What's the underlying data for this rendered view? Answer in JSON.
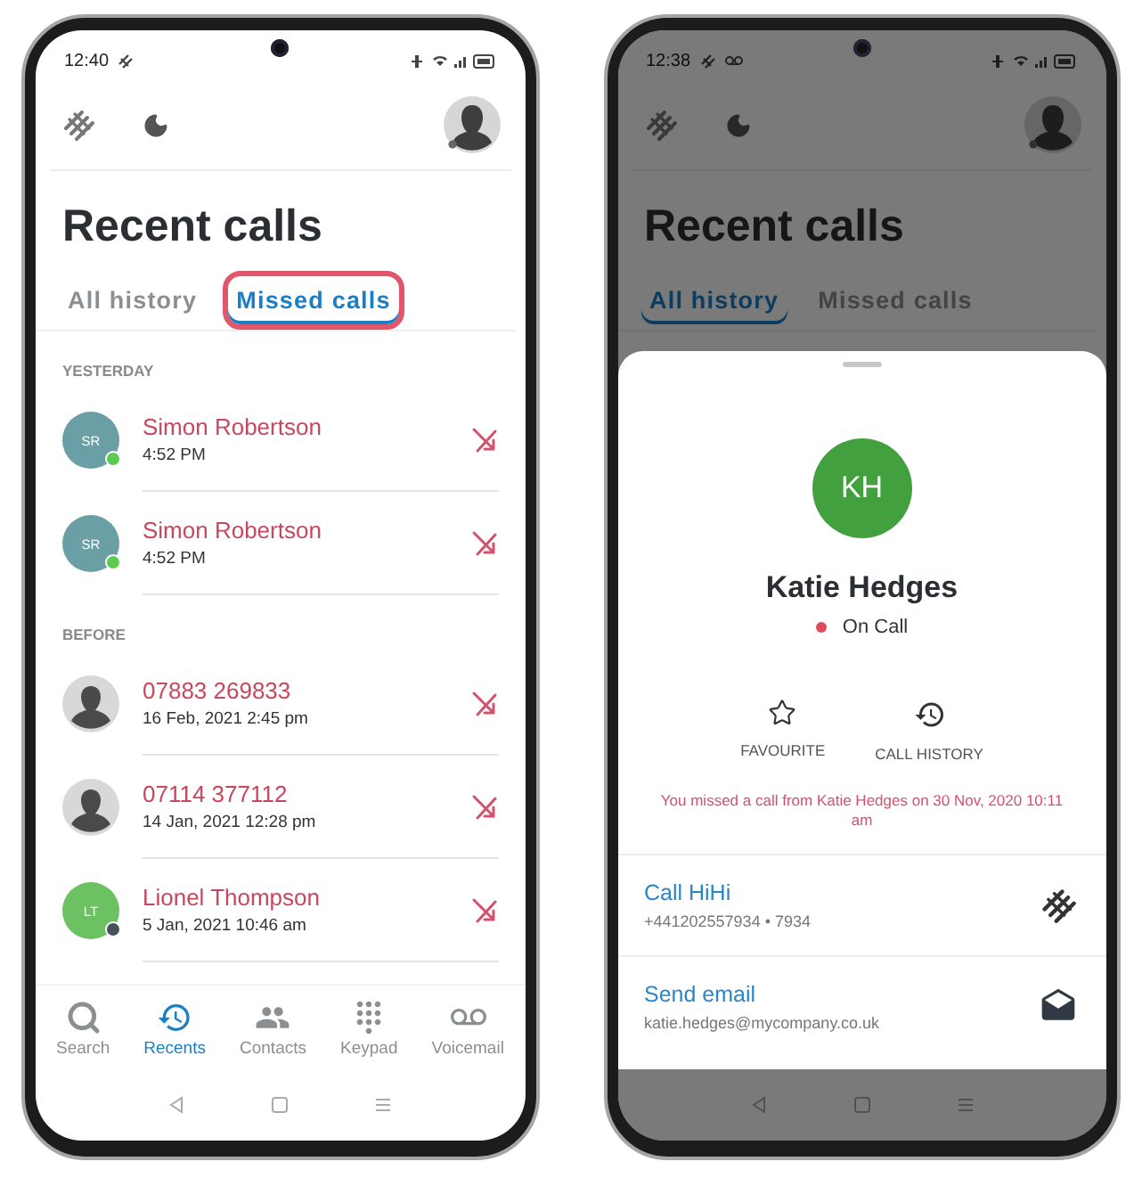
{
  "recent_calls_screen": {
    "status_bar": {
      "time": "12:40"
    },
    "title": "Recent calls",
    "tabs": [
      {
        "label": "All history",
        "selected": false,
        "highlighted": false
      },
      {
        "label": "Missed calls",
        "selected": true,
        "highlighted": true
      }
    ],
    "sections": [
      {
        "heading": "YESTERDAY",
        "calls": [
          {
            "name": "Simon Robertson",
            "time": "4:52 PM",
            "avatar": {
              "kind": "initials",
              "initials": "SR",
              "color": "#6a9fa6"
            },
            "presence": {
              "color": "#5cc94f"
            }
          },
          {
            "name": "Simon Robertson",
            "time": "4:52 PM",
            "avatar": {
              "kind": "initials",
              "initials": "SR",
              "color": "#6a9fa6"
            },
            "presence": {
              "color": "#5cc94f"
            }
          }
        ]
      },
      {
        "heading": "BEFORE",
        "calls": [
          {
            "name": "07883 269833",
            "time": "16 Feb, 2021 2:45 pm",
            "avatar": {
              "kind": "silhouette"
            }
          },
          {
            "name": "07114 377112",
            "time": "14 Jan, 2021 12:28 pm",
            "avatar": {
              "kind": "silhouette"
            }
          },
          {
            "name": "Lionel Thompson",
            "time": "5 Jan, 2021 10:46 am",
            "avatar": {
              "kind": "initials",
              "initials": "LT",
              "color": "#6cc162"
            },
            "presence": {
              "color": "#4a5058"
            }
          }
        ]
      }
    ],
    "nav": [
      {
        "label": "Search",
        "kind": "search",
        "selected": false
      },
      {
        "label": "Recents",
        "kind": "recents",
        "selected": true
      },
      {
        "label": "Contacts",
        "kind": "contacts",
        "selected": false
      },
      {
        "label": "Keypad",
        "kind": "keypad",
        "selected": false
      },
      {
        "label": "Voicemail",
        "kind": "voicemail",
        "selected": false
      }
    ]
  },
  "contact_screen": {
    "status_bar": {
      "time": "12:38"
    },
    "title": "Recent calls",
    "tabs": [
      {
        "label": "All history",
        "selected": true,
        "highlighted": false
      },
      {
        "label": "Missed calls",
        "selected": false,
        "highlighted": false
      }
    ],
    "sheet": {
      "avatar": {
        "initials": "KH",
        "color": "#43a03f"
      },
      "name": "Katie Hedges",
      "status": {
        "label": "On Call",
        "color": "#e04a5e"
      },
      "actions": [
        {
          "label": "FAVOURITE",
          "kind": "favourite"
        },
        {
          "label": "CALL HISTORY",
          "kind": "history"
        }
      ],
      "notice": "You missed a call from Katie Hedges on 30 Nov, 2020 10:11 am",
      "contact_actions": [
        {
          "title": "Call HiHi",
          "detail": "+441202557934 • 7934",
          "kind": "call"
        },
        {
          "title": "Send email",
          "detail": "katie.hedges@mycompany.co.uk",
          "kind": "email"
        }
      ]
    }
  }
}
